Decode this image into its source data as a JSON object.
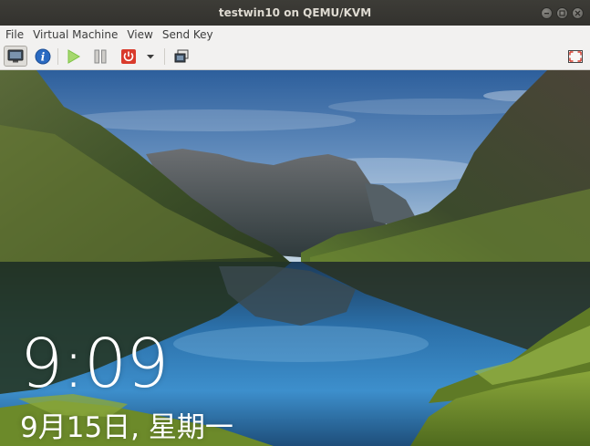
{
  "window": {
    "title": "testwin10 on QEMU/KVM",
    "wm_buttons": [
      "minimize-icon",
      "maximize-icon",
      "close-icon"
    ]
  },
  "menubar": {
    "items": [
      "File",
      "Virtual Machine",
      "View",
      "Send Key"
    ]
  },
  "toolbar": {
    "buttons": [
      {
        "icon": "monitor-icon",
        "active": true
      },
      {
        "icon": "info-icon",
        "color": "#2a6ac2"
      },
      {
        "icon": "play-icon",
        "color": "#7cc243"
      },
      {
        "icon": "pause-icon",
        "color": "#8a8a8a"
      },
      {
        "icon": "power-icon",
        "color": "#d93a2b"
      },
      {
        "icon": "chevron-down-icon"
      },
      {
        "icon": "screenshot-icon"
      },
      {
        "icon": "fullscreen-icon"
      }
    ]
  },
  "lockscreen": {
    "time": "9:09",
    "date": "9月15日, 星期一"
  }
}
